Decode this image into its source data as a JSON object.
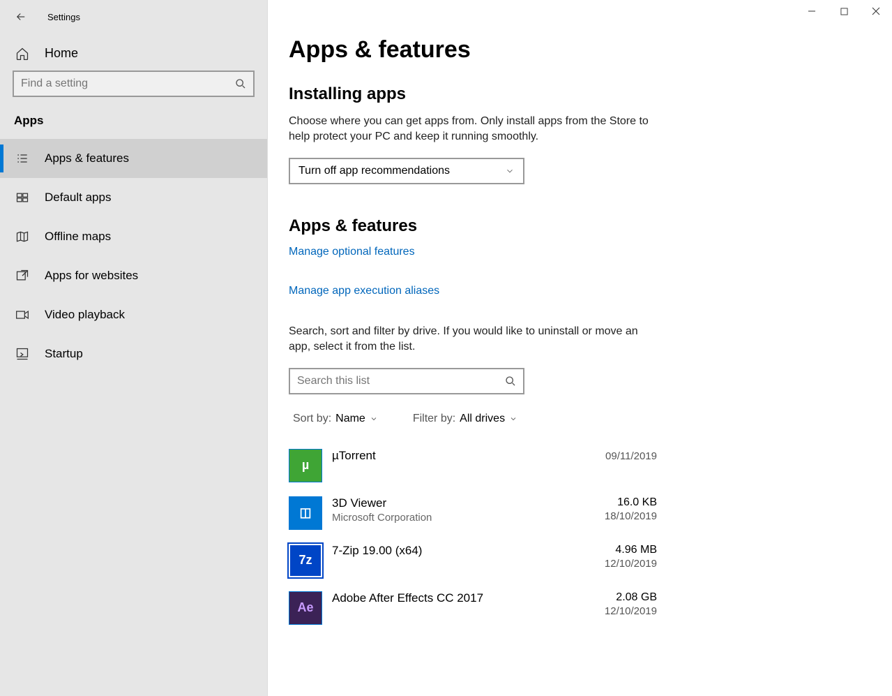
{
  "window": {
    "title": "Settings"
  },
  "sidebar": {
    "home_label": "Home",
    "search_placeholder": "Find a setting",
    "section_label": "Apps",
    "items": [
      {
        "label": "Apps & features"
      },
      {
        "label": "Default apps"
      },
      {
        "label": "Offline maps"
      },
      {
        "label": "Apps for websites"
      },
      {
        "label": "Video playback"
      },
      {
        "label": "Startup"
      }
    ]
  },
  "main": {
    "page_title": "Apps & features",
    "installing": {
      "heading": "Installing apps",
      "description": "Choose where you can get apps from. Only install apps from the Store to help protect your PC and keep it running smoothly.",
      "dropdown_value": "Turn off app recommendations"
    },
    "apps_features": {
      "heading": "Apps & features",
      "link_optional": "Manage optional features",
      "link_aliases": "Manage app execution aliases",
      "description": "Search, sort and filter by drive. If you would like to uninstall or move an app, select it from the list.",
      "search_placeholder": "Search this list",
      "sort_label": "Sort by:",
      "sort_value": "Name",
      "filter_label": "Filter by:",
      "filter_value": "All drives",
      "apps": [
        {
          "name": "µTorrent",
          "publisher": "",
          "size": "",
          "date": "09/11/2019",
          "icon_bg": "#3fa535",
          "icon_text": "µ"
        },
        {
          "name": "3D Viewer",
          "publisher": "Microsoft Corporation",
          "size": "16.0 KB",
          "date": "18/10/2019",
          "icon_bg": "#0078d4",
          "icon_text": "◫"
        },
        {
          "name": "7-Zip 19.00 (x64)",
          "publisher": "",
          "size": "4.96 MB",
          "date": "12/10/2019",
          "icon_bg": "#0045c6",
          "icon_text": "7z"
        },
        {
          "name": "Adobe After Effects CC 2017",
          "publisher": "",
          "size": "2.08 GB",
          "date": "12/10/2019",
          "icon_bg": "#3b2256",
          "icon_text": "Ae"
        }
      ]
    }
  }
}
